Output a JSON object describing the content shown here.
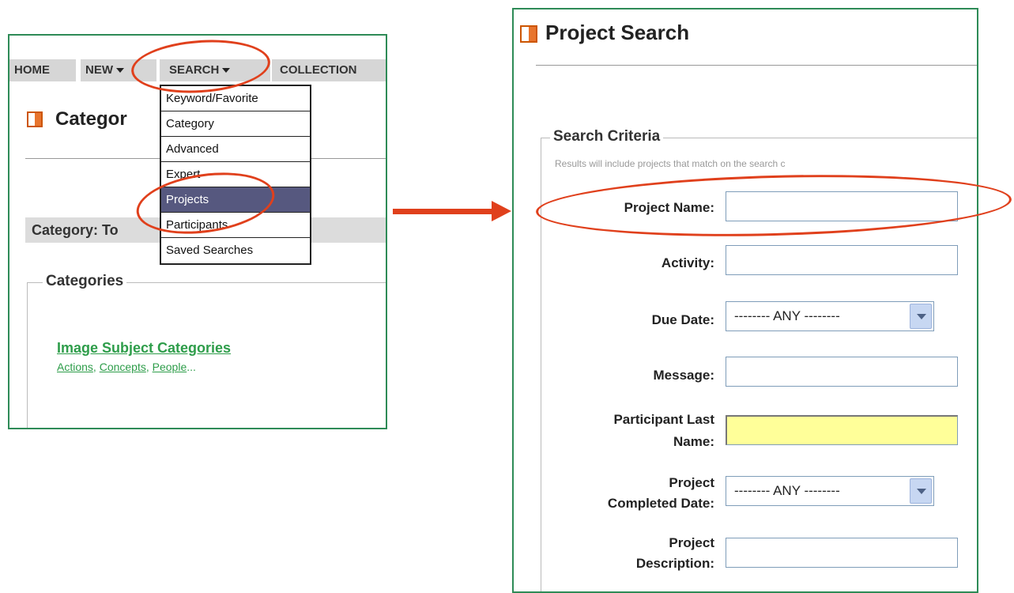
{
  "nav": {
    "home": "HOME",
    "new": "NEW",
    "search": "SEARCH",
    "collections": "COLLECTION"
  },
  "left": {
    "heading": "Categor",
    "category_bar": "Category: To",
    "categories_legend": "Categories",
    "link_title": "Image Subject Categories",
    "sublinks": [
      "Actions",
      "Concepts",
      "People"
    ],
    "sublink_sep": ", ",
    "sublink_more": "..."
  },
  "search_menu": {
    "items": [
      "Keyword/Favorite",
      "Category",
      "Advanced",
      "Expert",
      "Projects",
      "Participants",
      "Saved Searches"
    ],
    "active_item": "Projects"
  },
  "right": {
    "heading": "Project Search",
    "criteria_legend": "Search Criteria",
    "note": "Results will include projects that match on the search c",
    "fields": {
      "project_name": "Project Name:",
      "activity": "Activity:",
      "due_date": "Due Date:",
      "message": "Message:",
      "participant_last_name_1": "Participant Last",
      "participant_last_name_2": "Name:",
      "completed_date_1": "Project",
      "completed_date_2": "Completed Date:",
      "description_1": "Project",
      "description_2": "Description:"
    },
    "due_date_value": "-------- ANY --------",
    "completed_date_value": "-------- ANY --------"
  },
  "colors": {
    "panel_border": "#2e8b57",
    "annotation": "#e0401c",
    "menu_active": "#56587f",
    "link": "#2e9d4a",
    "highlight_input": "#ffff99"
  }
}
